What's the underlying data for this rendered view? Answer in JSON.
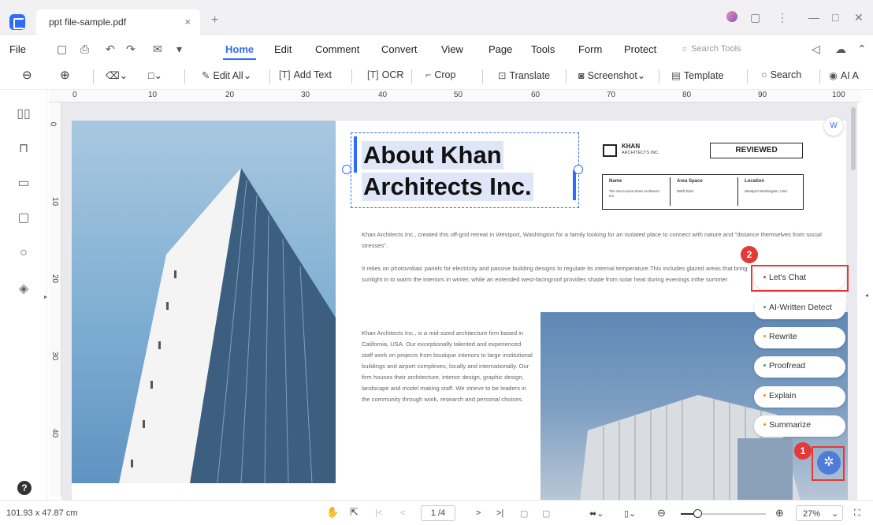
{
  "window": {
    "tab_title": "ppt file-sample.pdf"
  },
  "menu": [
    "File",
    "Home",
    "Edit",
    "Comment",
    "Convert",
    "View",
    "Page",
    "Tools",
    "Form",
    "Protect"
  ],
  "menu_active": "Home",
  "search_tools": "Search Tools",
  "toolbar": {
    "edit_all": "Edit All",
    "add_text": "Add Text",
    "ocr": "OCR",
    "crop": "Crop",
    "translate": "Translate",
    "screenshot": "Screenshot",
    "template": "Template",
    "search": "Search",
    "ai": "AI A"
  },
  "ruler_h": [
    "0",
    "10",
    "20",
    "30",
    "40",
    "50",
    "60",
    "70",
    "80",
    "90",
    "100"
  ],
  "ruler_v": [
    "0",
    "10",
    "20",
    "30",
    "40"
  ],
  "document": {
    "heading_line1": "About Khan",
    "heading_line2": "Architects Inc.",
    "logo_name": "KHAN",
    "logo_sub": "ARCHITECTS INC.",
    "reviewed": "REVIEWED",
    "table_headers": [
      "Name",
      "Area Space",
      "Location"
    ],
    "table_values": [
      "The Sea House Khan Architects Inc.",
      "550ft Total",
      "Westport Washington, USA"
    ],
    "para1": "Khan Architects Inc., created this off-grid retreat in Westport, Washington for a family looking for an isolated place to connect with nature and \"distance themselves from social stresses\".",
    "para2": "It relies on photovoltaic panels for electricity and passive building designs to regulate its internal temperature.This includes glazed areas that bring sunlight in to warm the interiors in winter, while an extended west-facingroof provides shade from solar heat during evenings inthe summer.",
    "para3": "Khan Architects Inc., is a mid-sized architecture firm based in California, USA. Our exceptionally talented and experienced staff work on projects from boutique interiors to large institutional buildings and airport complexes, locally and internationally. Our firm houses their architecture, interior design, graphic design, landscape and model making staff. We strieve to be leaders in the community through work, research and personal choices."
  },
  "ai_menu": [
    {
      "label": "Let's Chat",
      "color": "#e53935"
    },
    {
      "label": "AI-Written Detect",
      "color": "#43a047"
    },
    {
      "label": "Rewrite",
      "color": "#fb8c00"
    },
    {
      "label": "Proofread",
      "color": "#43a047"
    },
    {
      "label": "Explain",
      "color": "#fb8c00"
    },
    {
      "label": "Summarize",
      "color": "#fb8c00"
    }
  ],
  "badges": [
    "1",
    "2"
  ],
  "status": {
    "dimensions": "101.93 x 47.87 cm",
    "page": "1 /4",
    "zoom": "27%"
  }
}
